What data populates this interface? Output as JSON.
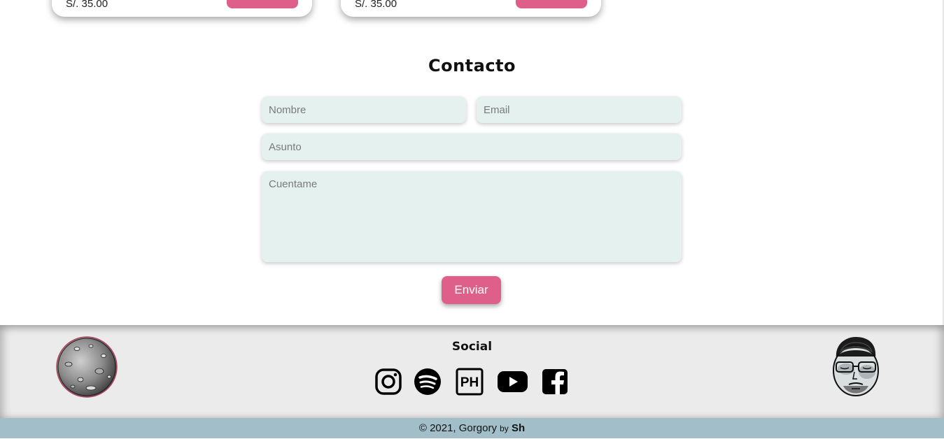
{
  "products": [
    {
      "price": "S/. 35.00"
    },
    {
      "price": "S/. 35.00"
    }
  ],
  "contact": {
    "title": "Contacto",
    "name_placeholder": "Nombre",
    "email_placeholder": "Email",
    "subject_placeholder": "Asunto",
    "message_placeholder": "Cuentame",
    "send_label": "Enviar"
  },
  "footer": {
    "social_title": "Social",
    "social_icons": [
      "instagram-icon",
      "spotify-icon",
      "producthunt-icon",
      "youtube-icon",
      "facebook-icon"
    ],
    "ph_label": "PH",
    "copyright": "© 2021, Gorgory",
    "by": "by",
    "author": "Sh"
  },
  "colors": {
    "accent": "#df5f8b",
    "field_bg": "#e4f1ef",
    "footer_bg": "#ebebeb",
    "copyright_bg": "#a2bec8"
  }
}
